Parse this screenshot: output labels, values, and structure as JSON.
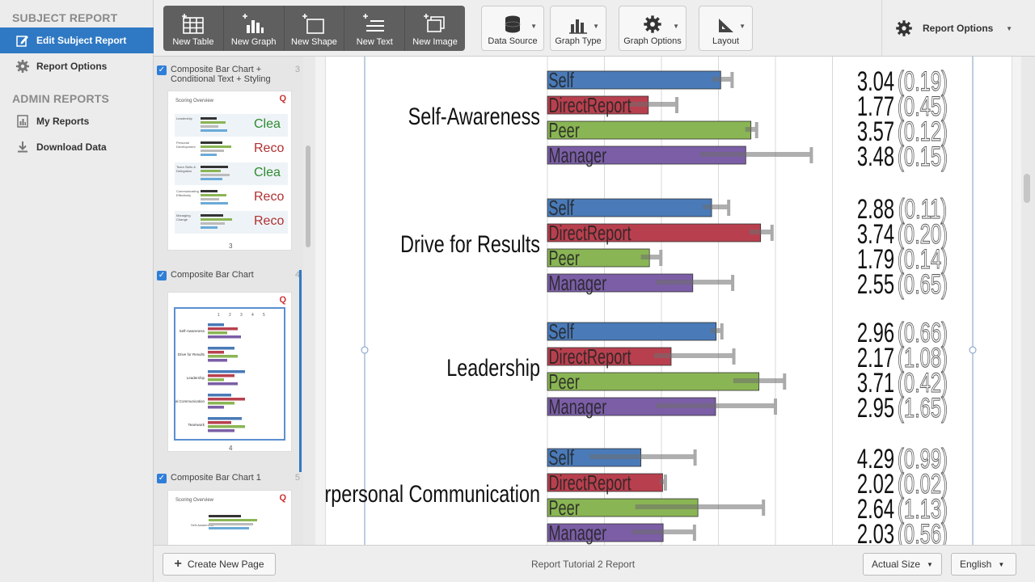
{
  "nav": {
    "section1": "SUBJECT REPORT",
    "edit": "Edit Subject Report",
    "options": "Report Options",
    "section2": "ADMIN REPORTS",
    "my_reports": "My Reports",
    "download": "Download Data"
  },
  "toolbar": {
    "new_table": "New Table",
    "new_graph": "New Graph",
    "new_shape": "New Shape",
    "new_text": "New Text",
    "new_image": "New Image",
    "data_source": "Data Source",
    "graph_type": "Graph Type",
    "graph_options": "Graph Options",
    "layout": "Layout",
    "report_options": "Report Options"
  },
  "thumbs": [
    {
      "title": "Composite Bar Chart + Conditional Text + Styling",
      "num": "3",
      "heading": "Scoring Overview",
      "rows": [
        {
          "label": "Leadership",
          "status": "Clea",
          "color": "#2e8b2e"
        },
        {
          "label": "Personal Development",
          "status": "Reco",
          "color": "#b03030"
        },
        {
          "label": "Team Skills & Delegation",
          "status": "Clea",
          "color": "#2e8b2e"
        },
        {
          "label": "Communicating Effectively",
          "status": "Reco",
          "color": "#b03030"
        },
        {
          "label": "Managing Change",
          "status": "Reco",
          "color": "#b03030"
        }
      ],
      "page": "3"
    },
    {
      "title": "Composite Bar Chart",
      "num": "4",
      "page": "4",
      "categories": [
        "Self-Awareness",
        "Drive for Results",
        "Leadership",
        "Interpersonal Communication",
        "Teamwork"
      ]
    },
    {
      "title": "Composite Bar Chart 1",
      "num": "5",
      "heading": "Scoring Overview",
      "category": "Self-Awareness"
    }
  ],
  "chart_data": {
    "type": "bar",
    "series_labels": [
      "Self",
      "DirectReport",
      "Peer",
      "Manager"
    ],
    "series_colors": [
      "#4a7ab8",
      "#b8404e",
      "#8ab554",
      "#7b5ea6"
    ],
    "groups": [
      {
        "name": "Self-Awareness",
        "means": [
          "3.04",
          "1.77",
          "3.57",
          "3.48"
        ],
        "sds": [
          "(0.19)",
          "(0.45)",
          "(0.12)",
          "(0.15)"
        ],
        "values": [
          3.04,
          1.77,
          3.57,
          3.48
        ]
      },
      {
        "name": "Drive for Results",
        "means": [
          "2.88",
          "3.74",
          "1.79",
          "2.55"
        ],
        "sds": [
          "(0.11)",
          "(0.20)",
          "(0.14)",
          "(0.65)"
        ],
        "values": [
          2.88,
          3.74,
          1.79,
          2.55
        ]
      },
      {
        "name": "Leadership",
        "means": [
          "2.96",
          "2.17",
          "3.71",
          "2.95"
        ],
        "sds": [
          "(0.66)",
          "(1.08)",
          "(0.42)",
          "(1.65)"
        ],
        "values": [
          2.96,
          2.17,
          3.71,
          2.95
        ]
      },
      {
        "name": "Interpersonal Communication",
        "means": [
          "4.29",
          "2.02",
          "2.64",
          "2.03"
        ],
        "sds": [
          "(0.99)",
          "(0.02)",
          "(1.13)",
          "(0.56)"
        ],
        "values": [
          1.64,
          2.02,
          2.64,
          2.03
        ]
      }
    ]
  },
  "bottom": {
    "create_page": "Create New Page",
    "report_name": "Report Tutorial 2 Report",
    "zoom": "Actual Size",
    "language": "English"
  }
}
